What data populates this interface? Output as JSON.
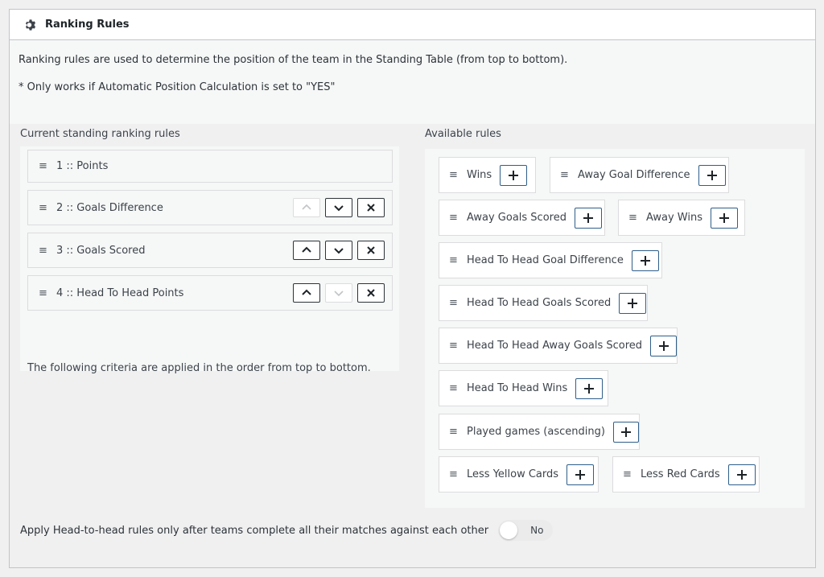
{
  "header": {
    "title": "Ranking Rules",
    "icon": "gear-icon"
  },
  "intro": {
    "line1": "Ranking rules are used to determine the position of the team in the Standing Table (from top to bottom).",
    "line2": "* Only works if Automatic Position Calculation is set to \"YES\""
  },
  "current": {
    "label": "Current standing ranking rules",
    "rules": [
      {
        "label": "1 :: Points"
      },
      {
        "label": "2 :: Goals Difference"
      },
      {
        "label": "3 :: Goals Scored"
      },
      {
        "label": "4 :: Head To Head Points"
      }
    ],
    "note": "The following criteria are applied in the order from top to bottom."
  },
  "available": {
    "label": "Available rules",
    "rules": [
      {
        "label": "Wins"
      },
      {
        "label": "Away Goal Difference"
      },
      {
        "label": "Away Goals Scored"
      },
      {
        "label": "Away Wins"
      },
      {
        "label": "Head To Head Goal Difference"
      },
      {
        "label": "Head To Head Goals Scored"
      },
      {
        "label": "Head To Head Away Goals Scored"
      },
      {
        "label": "Head To Head Wins"
      },
      {
        "label": "Played games (ascending)"
      },
      {
        "label": "Less Yellow Cards"
      },
      {
        "label": "Less Red Cards"
      }
    ]
  },
  "footer": {
    "label": "Apply Head-to-head rules only after teams complete all their matches against each other",
    "toggle_state": "No"
  },
  "colors": {
    "border": "#c3c4c7",
    "add_button_border": "#2f5e8a",
    "button_border": "#2c3338"
  }
}
